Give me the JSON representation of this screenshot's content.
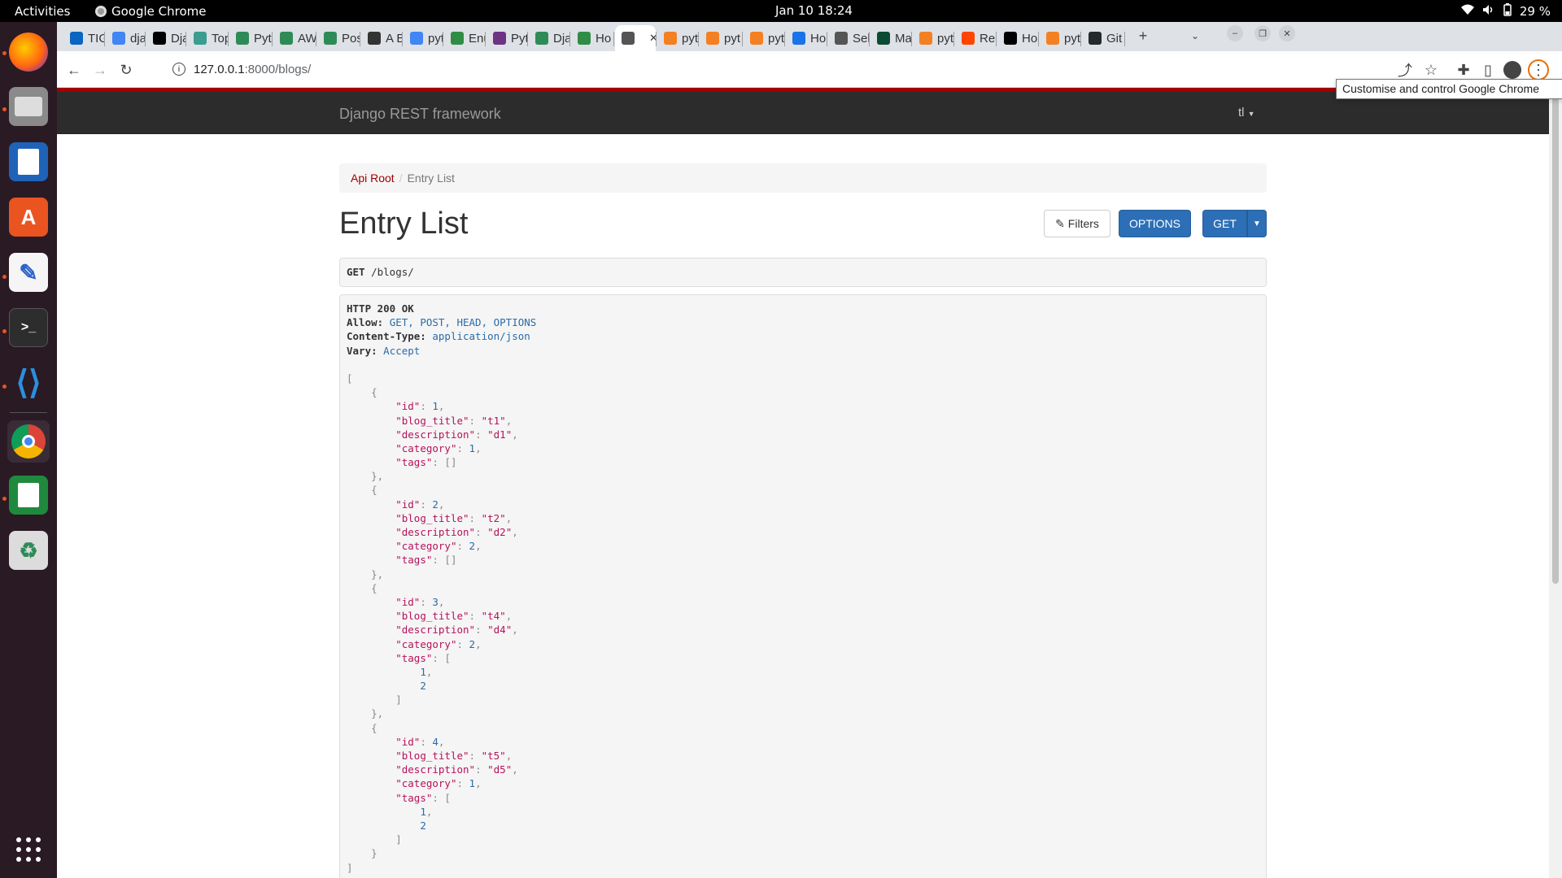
{
  "topbar": {
    "activities": "Activities",
    "app_name": "Google Chrome",
    "clock": "Jan 10  18:24",
    "battery": "29 %"
  },
  "dock": {
    "items": [
      "firefox",
      "files",
      "writer",
      "app-center",
      "text-editor",
      "terminal",
      "vscode",
      "chrome",
      "calc",
      "trash",
      "show-apps"
    ]
  },
  "browser": {
    "tabs": [
      {
        "label": "TIG",
        "icon": "linkedin-icon",
        "color": "#0a66c2"
      },
      {
        "label": "dja",
        "icon": "google-icon",
        "color": "#4285f4"
      },
      {
        "label": "Dja",
        "icon": "dev-icon",
        "color": "#000000"
      },
      {
        "label": "Top",
        "icon": "chart-icon",
        "color": "#3a9d8f"
      },
      {
        "label": "Pyt",
        "icon": "w-icon",
        "color": "#2e8b57"
      },
      {
        "label": "AW",
        "icon": "w-icon",
        "color": "#2e8b57"
      },
      {
        "label": "Pos",
        "icon": "w-icon",
        "color": "#2e8b57"
      },
      {
        "label": "A B",
        "icon": "medium-icon",
        "color": "#333333"
      },
      {
        "label": "pyt",
        "icon": "google-icon",
        "color": "#4285f4"
      },
      {
        "label": "Enu",
        "icon": "geeks-icon",
        "color": "#2f8d46"
      },
      {
        "label": "Pyt",
        "icon": "sd-icon",
        "color": "#6c3483"
      },
      {
        "label": "Dja",
        "icon": "w-icon",
        "color": "#2e8b57"
      },
      {
        "label": "Ho",
        "icon": "geeks-icon",
        "color": "#2f8d46"
      },
      {
        "label": "",
        "icon": "globe-icon",
        "color": "#555555"
      },
      {
        "label": "pyt",
        "icon": "stackoverflow-icon",
        "color": "#f48024"
      },
      {
        "label": "pyt",
        "icon": "stackoverflow-icon",
        "color": "#f48024"
      },
      {
        "label": "pyt",
        "icon": "stackoverflow-icon",
        "color": "#f48024"
      },
      {
        "label": "Ho",
        "icon": "drive-icon",
        "color": "#1a73e8"
      },
      {
        "label": "Sel",
        "icon": "globe-icon",
        "color": "#555555"
      },
      {
        "label": "Ma",
        "icon": "dj-icon",
        "color": "#0c4b33"
      },
      {
        "label": "pyt",
        "icon": "stackoverflow-icon",
        "color": "#f48024"
      },
      {
        "label": "Rep",
        "icon": "reddit-icon",
        "color": "#ff4500"
      },
      {
        "label": "Ho",
        "icon": "medium-icon",
        "color": "#000000"
      },
      {
        "label": "pyt",
        "icon": "stackoverflow-icon",
        "color": "#f48024"
      },
      {
        "label": "Git",
        "icon": "github-icon",
        "color": "#24292e"
      }
    ],
    "url_host": "127.0.0.1",
    "url_path": ":8000/blogs/",
    "tooltip": "Customise and control Google Chrome"
  },
  "drf": {
    "brand": "Django REST framework",
    "user": "tl",
    "breadcrumb_root": "Api Root",
    "breadcrumb_current": "Entry List",
    "title": "Entry List",
    "filters_label": "Filters",
    "options_label": "OPTIONS",
    "get_label": "GET",
    "request_method": "GET",
    "request_path": "/blogs/",
    "status": "HTTP 200 OK",
    "headers": [
      {
        "key": "Allow:",
        "value": "GET, POST, HEAD, OPTIONS"
      },
      {
        "key": "Content-Type:",
        "value": "application/json"
      },
      {
        "key": "Vary:",
        "value": "Accept"
      }
    ],
    "entries": [
      {
        "id": 1,
        "blog_title": "t1",
        "description": "d1",
        "category": 1,
        "tags": []
      },
      {
        "id": 2,
        "blog_title": "t2",
        "description": "d2",
        "category": 2,
        "tags": []
      },
      {
        "id": 3,
        "blog_title": "t4",
        "description": "d4",
        "category": 2,
        "tags": [
          1,
          2
        ]
      },
      {
        "id": 4,
        "blog_title": "t5",
        "description": "d5",
        "category": 1,
        "tags": [
          1,
          2
        ]
      }
    ]
  }
}
